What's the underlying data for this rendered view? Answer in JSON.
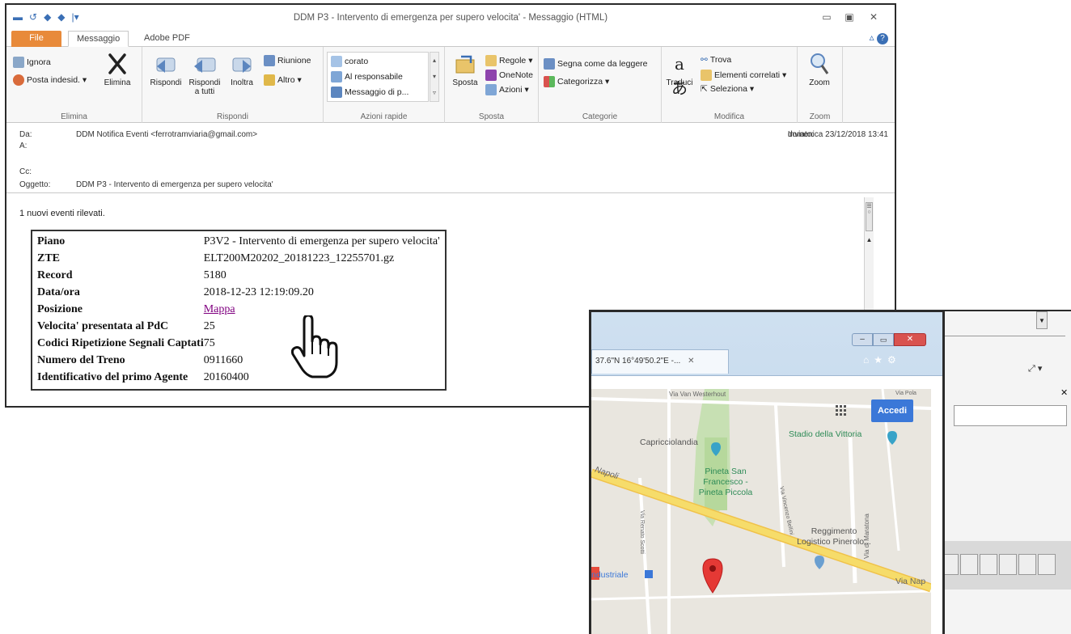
{
  "outlook": {
    "title": "DDM P3 - Intervento di emergenza per supero velocita' - Messaggio (HTML)",
    "tabs": {
      "file": "File",
      "messaggio": "Messaggio",
      "adobe": "Adobe PDF"
    },
    "ribbon": {
      "elimina": {
        "ignora": "Ignora",
        "posta": "Posta indesid. ▾",
        "elimina": "Elimina",
        "label": "Elimina"
      },
      "rispondi": {
        "rispondi": "Rispondi",
        "rispondi_tutti_1": "Rispondi",
        "rispondi_tutti_2": "a tutti",
        "inoltra": "Inoltra",
        "riunione": "Riunione",
        "altro": "Altro ▾",
        "label": "Rispondi"
      },
      "azioni": {
        "item1": "corato",
        "item2": "Al responsabile",
        "item3": "Messaggio di p...",
        "label": "Azioni rapide"
      },
      "sposta": {
        "sposta": "Sposta",
        "regole": "Regole ▾",
        "onenote": "OneNote",
        "azioni": "Azioni ▾",
        "label": "Sposta"
      },
      "categorie": {
        "segna": "Segna come da leggere",
        "categorizza": "Categorizza ▾",
        "label": "Categorie"
      },
      "modifica": {
        "traduci": "Traduci",
        "trova": "Trova",
        "elementi": "Elementi correlati ▾",
        "seleziona": "Seleziona ▾",
        "label": "Modifica"
      },
      "zoom": {
        "zoom": "Zoom",
        "label": "Zoom"
      }
    },
    "header": {
      "da_label": "Da:",
      "da_value": "DDM Notifica Eventi <ferrotramviaria@gmail.com>",
      "a_label": "A:",
      "cc_label": "Cc:",
      "oggetto_label": "Oggetto:",
      "oggetto_value": "DDM P3 - Intervento di emergenza per supero velocita'",
      "inviato_label": "Inviato:",
      "inviato_value": "domenica 23/12/2018 13:41"
    },
    "body": {
      "intro": "1 nuovi eventi rilevati.",
      "rows": [
        {
          "k": "Piano",
          "v": "P3V2 - Intervento di emergenza per supero velocita'"
        },
        {
          "k": "ZTE",
          "v": "ELT200M20202_20181223_12255701.gz"
        },
        {
          "k": "Record",
          "v": "5180"
        },
        {
          "k": "Data/ora",
          "v": "2018-12-23 12:19:09.20"
        },
        {
          "k": "Posizione",
          "v": "Mappa"
        },
        {
          "k": "Velocita' presentata al PdC",
          "v": "25"
        },
        {
          "k": "Codici Ripetizione Segnali Captati",
          "v": "75"
        },
        {
          "k": "Numero del Treno",
          "v": "0911660"
        },
        {
          "k": "Identificativo del primo Agente",
          "v": "20160400"
        }
      ]
    }
  },
  "browser": {
    "tab_title": "37.6\"N 16°49'50.2\"E -...",
    "accedi": "Accedi",
    "map": {
      "via_westerhout": "Via Van Westerhout",
      "capricciolandia": "Capricciolandia",
      "stadio": "Stadio della Vittoria",
      "napoli": "Napoli",
      "pineta1": "Pineta San",
      "pineta2": "Francesco -",
      "pineta3": "Pineta Piccola",
      "via_maratona": "Via di Maratona",
      "reggimento1": "Reggimento",
      "reggimento2": "Logistico Pinerolo...",
      "industriale": "ndustriale",
      "via_nap": "Via Nap",
      "via_scotti": "Via Renato Scotti",
      "via_bellini": "Via Vincenzo Bellini",
      "via_pola": "Via Pola"
    }
  },
  "colors": {
    "file_tab": "#e88a3a",
    "link": "#800080",
    "accedi": "#3b78d8",
    "map_pin": "#e53935",
    "road": "#f6dc6a"
  }
}
